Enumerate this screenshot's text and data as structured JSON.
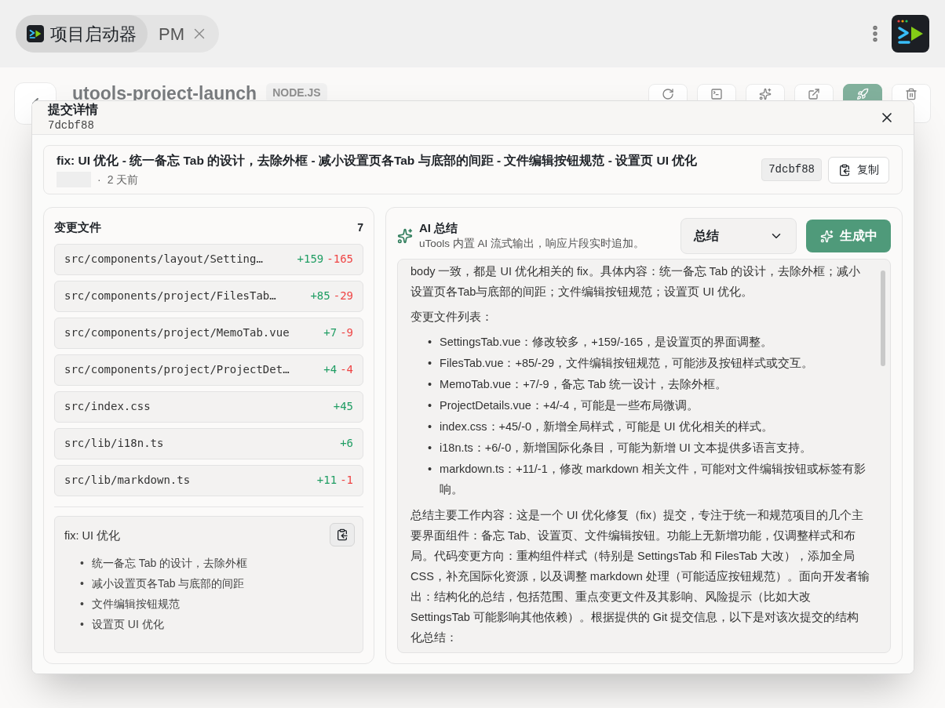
{
  "top_bar": {
    "tabs": [
      {
        "label": "项目启动器",
        "selected": true,
        "closable": false
      },
      {
        "label": "PM",
        "selected": false,
        "closable": true
      }
    ]
  },
  "project": {
    "name": "utools-project-launch",
    "badge": "NODE.JS"
  },
  "toolbar": [
    {
      "kind": "refresh"
    },
    {
      "kind": "terminal"
    },
    {
      "kind": "sparkle"
    },
    {
      "kind": "open"
    },
    {
      "kind": "launch"
    },
    {
      "kind": "delete"
    }
  ],
  "modal": {
    "title": "提交详情",
    "hash": "7dcbf88",
    "commit": {
      "message": "fix: UI 优化 - 统一备忘 Tab 的设计，去除外框 - 减小设置页各Tab 与底部的间距 - 文件编辑按钮规范 - 设置页 UI 优化",
      "separator": "·",
      "time": "2 天前",
      "hash": "7dcbf88",
      "copy_label": "复制"
    },
    "files": {
      "title": "变更文件",
      "count": "7",
      "items": [
        {
          "path": "src/components/layout/Setting…",
          "additions": "+159",
          "deletions": "-165"
        },
        {
          "path": "src/components/project/FilesTab…",
          "additions": "+85",
          "deletions": "-29"
        },
        {
          "path": "src/components/project/MemoTab.vue",
          "additions": "+7",
          "deletions": "-9"
        },
        {
          "path": "src/components/project/ProjectDet…",
          "additions": "+4",
          "deletions": "-4"
        },
        {
          "path": "src/index.css",
          "additions": "+45"
        },
        {
          "path": "src/lib/i18n.ts",
          "additions": "+6"
        },
        {
          "path": "src/lib/markdown.ts",
          "additions": "+11",
          "deletions": "-1"
        }
      ]
    },
    "commit_body": {
      "title": "fix: UI 优化",
      "marker": "•",
      "bullets": [
        "统一备忘 Tab 的设计，去除外框",
        "减小设置页各Tab 与底部的间距",
        "文件编辑按钮规范",
        "设置页 UI 优化"
      ]
    },
    "ai": {
      "title": "AI 总结",
      "subtitle": "uTools 内置 AI 流式输出，响应片段实时追加。",
      "mode": "总结",
      "generate_label": "生成中",
      "generating": true,
      "blocks": [
        {
          "kind": "paragraph",
          "text": "body 一致，都是 UI 优化相关的 fix。具体内容：统一备忘 Tab 的设计，去除外框；减小设置页各Tab与底部的间距；文件编辑按钮规范；设置页 UI 优化。"
        },
        {
          "kind": "paragraph",
          "text": "变更文件列表："
        },
        {
          "kind": "list",
          "marker": "•",
          "items": [
            "SettingsTab.vue：修改较多，+159/-165，是设置页的界面调整。",
            "FilesTab.vue：+85/-29，文件编辑按钮规范，可能涉及按钮样式或交互。",
            "MemoTab.vue：+7/-9，备忘 Tab 统一设计，去除外框。",
            "ProjectDetails.vue：+4/-4，可能是一些布局微调。",
            "index.css：+45/-0，新增全局样式，可能是 UI 优化相关的样式。",
            "i18n.ts：+6/-0，新增国际化条目，可能为新增 UI 文本提供多语言支持。",
            "markdown.ts：+11/-1，修改 markdown 相关文件，可能对文件编辑按钮或标签有影响。"
          ]
        },
        {
          "kind": "paragraph",
          "text": "总结主要工作内容：这是一个 UI 优化修复（fix）提交，专注于统一和规范项目的几个主要界面组件：备忘 Tab、设置页、文件编辑按钮。功能上无新增功能，仅调整样式和布局。代码变更方向：重构组件样式（特别是 SettingsTab 和 FilesTab 大改），添加全局 CSS，补充国际化资源，以及调整 markdown 处理（可能适应按钮规范）。面向开发者输出：结构化的总结，包括范围、重点变更文件及其影响、风险提示（比如大改 SettingsTab 可能影响其他依赖）。根据提供的 Git 提交信息，以下是对该次提交的结构化总结："
        }
      ]
    }
  }
}
